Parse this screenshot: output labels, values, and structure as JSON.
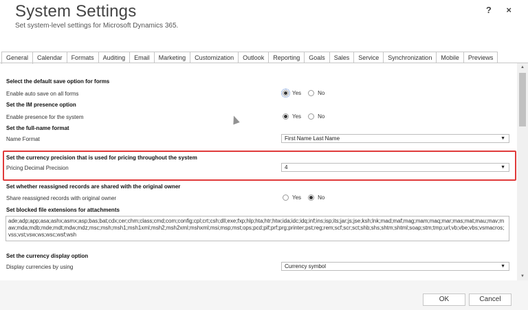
{
  "header": {
    "title": "System Settings",
    "subtitle": "Set system-level settings for Microsoft Dynamics 365.",
    "help_icon": "?",
    "close_icon": "×"
  },
  "tabs": [
    "General",
    "Calendar",
    "Formats",
    "Auditing",
    "Email",
    "Marketing",
    "Customization",
    "Outlook",
    "Reporting",
    "Goals",
    "Sales",
    "Service",
    "Synchronization",
    "Mobile",
    "Previews"
  ],
  "active_tab": "General",
  "sections": {
    "autosave": {
      "heading": "Select the default save option for forms",
      "label": "Enable auto save on all forms",
      "yes": "Yes",
      "no": "No",
      "selected": "Yes"
    },
    "presence": {
      "heading": "Set the IM presence option",
      "label": "Enable presence for the system",
      "yes": "Yes",
      "no": "No",
      "selected": "Yes"
    },
    "fullname": {
      "heading": "Set the full-name format",
      "label": "Name Format",
      "value": "First Name Last Name"
    },
    "currency_precision": {
      "heading": "Set the currency precision that is used for pricing throughout the system",
      "label": "Pricing Decimal Precision",
      "value": "4"
    },
    "reassign": {
      "heading": "Set whether reassigned records are shared with the original owner",
      "label": "Share reassigned records with original owner",
      "yes": "Yes",
      "no": "No",
      "selected": "No"
    },
    "blocked": {
      "heading": "Set blocked file extensions for attachments",
      "value": "ade;adp;app;asa;ashx;asmx;asp;bas;bat;cdx;cer;chm;class;cmd;com;config;cpl;crt;csh;dll;exe;fxp;hlp;hta;htr;htw;ida;idc;idq;inf;ins;isp;its;jar;js;jse;ksh;lnk;mad;maf;mag;mam;maq;mar;mas;mat;mau;mav;maw;mda;mdb;mde;mdt;mdw;mdz;msc;msh;msh1;msh1xml;msh2;msh2xml;mshxml;msi;msp;mst;ops;pcd;pif;prf;prg;printer;pst;reg;rem;scf;scr;sct;shb;shs;shtm;shtml;soap;stm;tmp;url;vb;vbe;vbs;vsmacros;vss;vst;vsw;ws;wsc;wsf;wsh"
    },
    "currency_display": {
      "heading": "Set the currency display option",
      "label": "Display currencies by using",
      "value": "Currency symbol"
    }
  },
  "footer": {
    "ok": "OK",
    "cancel": "Cancel"
  },
  "colors": {
    "highlight": "#e03a3a"
  }
}
